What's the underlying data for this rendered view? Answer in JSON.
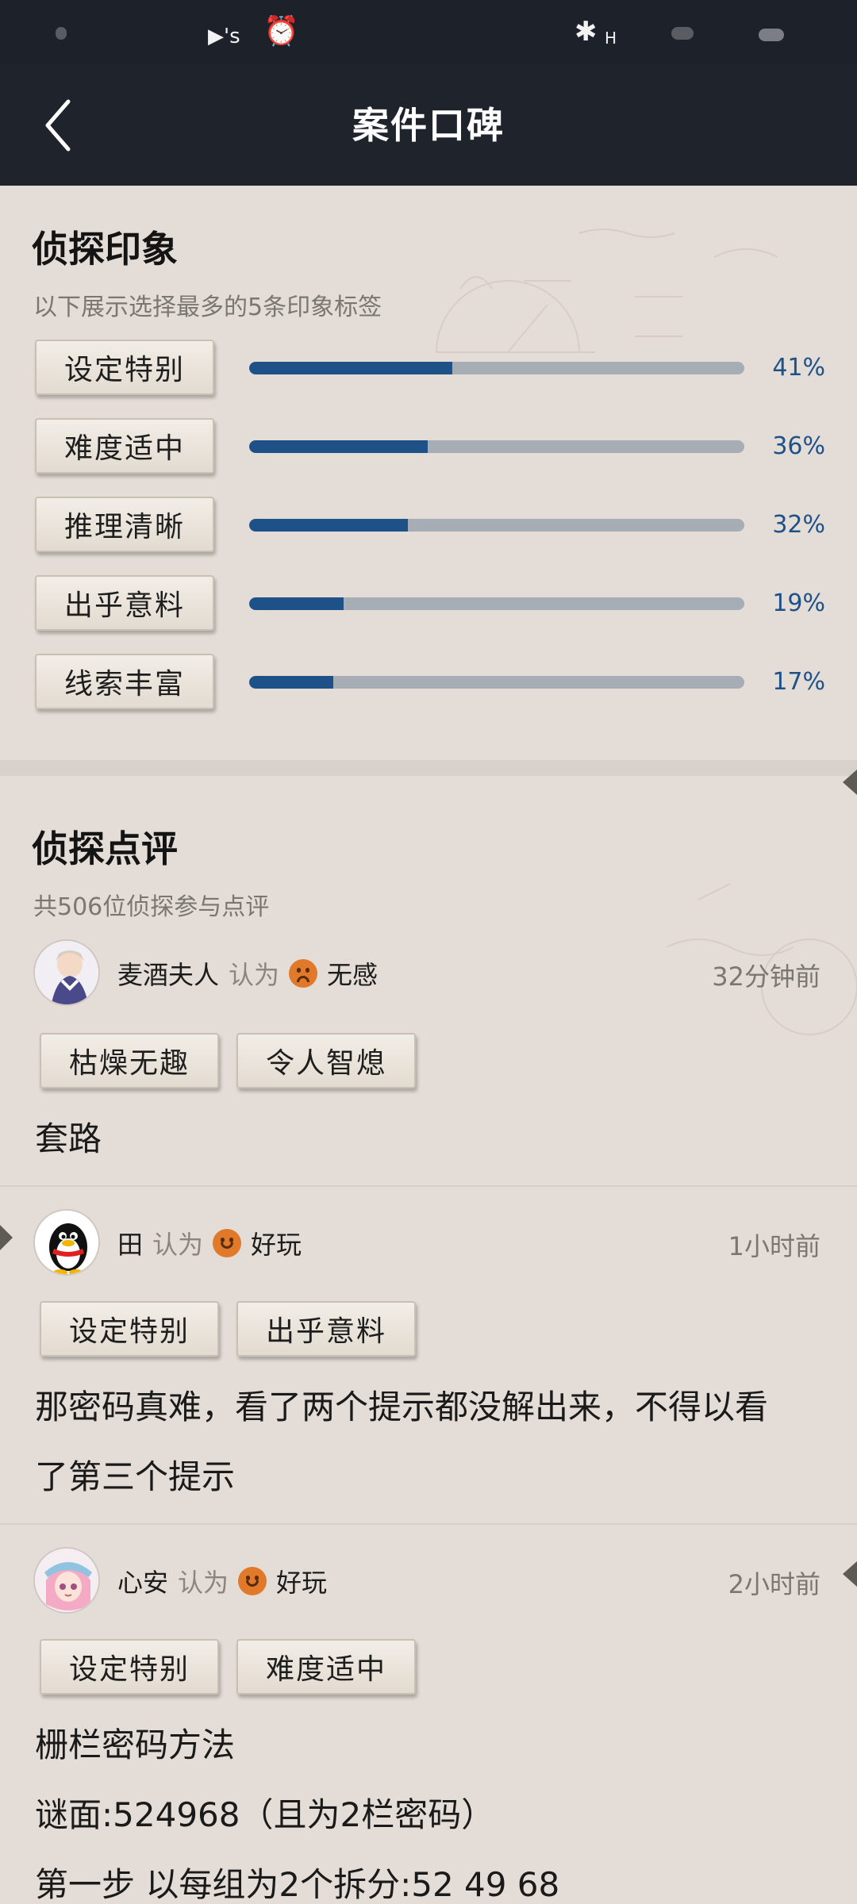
{
  "header": {
    "title": "案件口碑"
  },
  "impressions": {
    "title": "侦探印象",
    "subtitle": "以下展示选择最多的5条印象标签",
    "items": [
      {
        "label": "设定特别",
        "percent": 41,
        "percent_label": "41%"
      },
      {
        "label": "难度适中",
        "percent": 36,
        "percent_label": "36%"
      },
      {
        "label": "推理清晰",
        "percent": 32,
        "percent_label": "32%"
      },
      {
        "label": "出乎意料",
        "percent": 19,
        "percent_label": "19%"
      },
      {
        "label": "线索丰富",
        "percent": 17,
        "percent_label": "17%"
      }
    ]
  },
  "reviews": {
    "title": "侦探点评",
    "subtitle": "共506位侦探参与点评",
    "verb": "认为",
    "items": [
      {
        "user": "麦酒夫人",
        "rating": "无感",
        "mood": "sad",
        "time": "32分钟前",
        "tags": [
          "枯燥无趣",
          "令人智熄"
        ],
        "lines": [
          "套路"
        ]
      },
      {
        "user": "田",
        "rating": "好玩",
        "mood": "happy",
        "time": "1小时前",
        "tags": [
          "设定特别",
          "出乎意料"
        ],
        "lines": [
          "那密码真难，看了两个提示都没解出来，不得以看",
          "了第三个提示"
        ]
      },
      {
        "user": "心安",
        "rating": "好玩",
        "mood": "happy",
        "time": "2小时前",
        "tags": [
          "设定特别",
          "难度适中"
        ],
        "lines": [
          "栅栏密码方法",
          "谜面:524968（且为2栏密码）",
          "第一步 以每组为2个拆分:52 49 68"
        ]
      }
    ]
  }
}
